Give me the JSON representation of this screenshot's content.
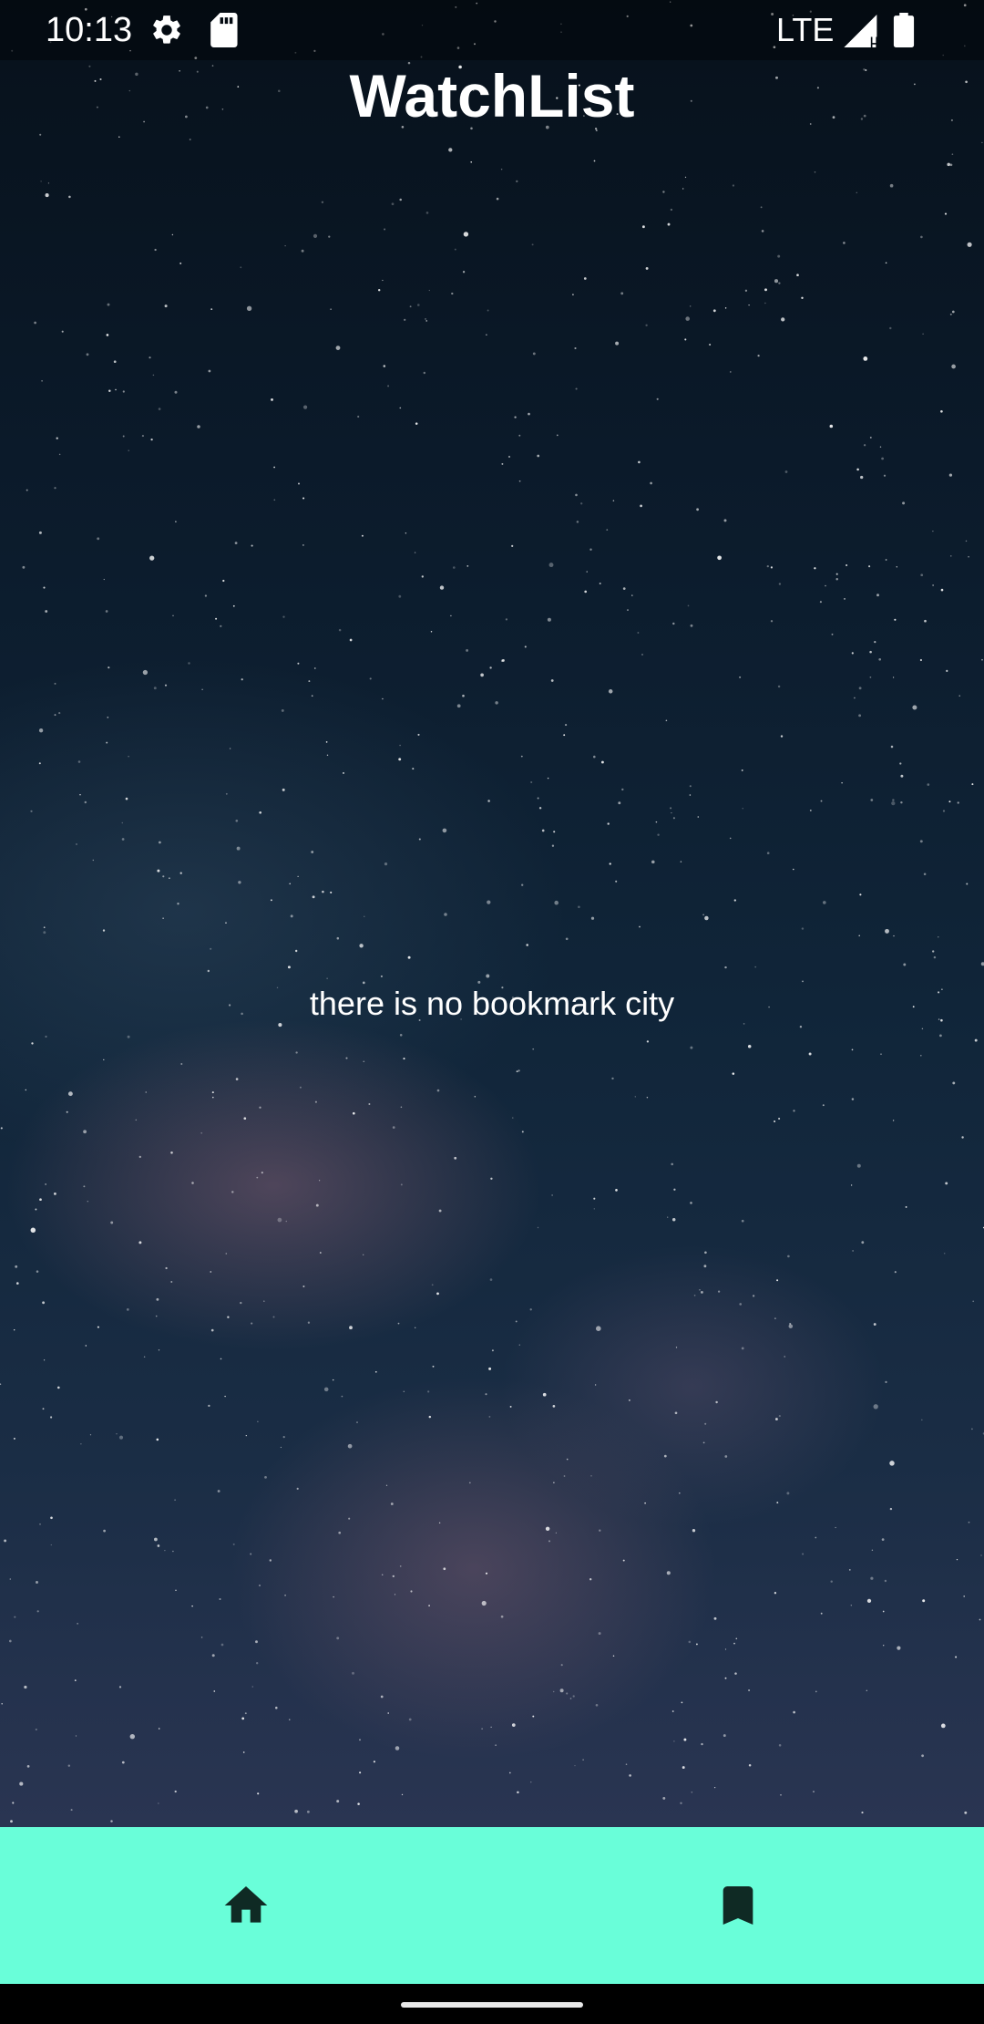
{
  "status_bar": {
    "time": "10:13",
    "network": "LTE",
    "icons": [
      "settings-icon",
      "sd-card-icon",
      "signal-icon",
      "battery-icon"
    ]
  },
  "app": {
    "title": "WatchList"
  },
  "main": {
    "empty_message": "there is no bookmark city"
  },
  "bottom_nav": {
    "background_color": "#69fed9",
    "icon_color": "#0f2a24",
    "items": [
      {
        "icon": "home-icon"
      },
      {
        "icon": "bookmark-icon"
      }
    ]
  }
}
